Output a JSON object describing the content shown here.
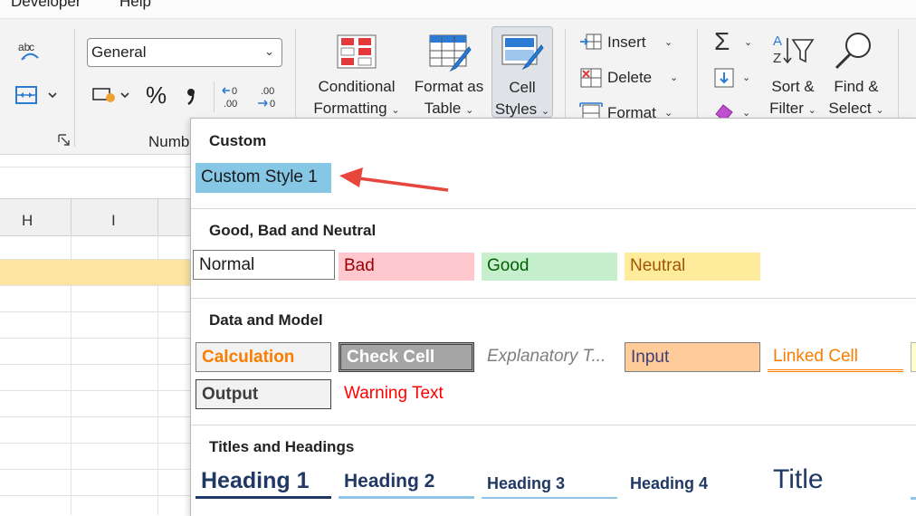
{
  "menubar": {
    "items": [
      "Developer",
      "Help"
    ]
  },
  "ribbon": {
    "number_format": "General",
    "number_group_label": "Numbe",
    "percent_symbol": "%",
    "comma_symbol": "̩",
    "increase_decimal": ".00",
    "decrease_decimal": ".00",
    "conditional_formatting": [
      "Conditional",
      "Formatting"
    ],
    "format_as_table": [
      "Format as",
      "Table"
    ],
    "cell_styles": [
      "Cell",
      "Styles"
    ],
    "insert": "Insert",
    "delete": "Delete",
    "format": "Format",
    "sort_filter": [
      "Sort &",
      "Filter"
    ],
    "find_select": [
      "Find &",
      "Select"
    ],
    "caret": "⌄"
  },
  "sheet": {
    "columns": [
      "H",
      "I"
    ],
    "highlight_color": "#fbe5a0"
  },
  "gallery": {
    "sections": {
      "custom": "Custom",
      "good_bad_neutral": "Good, Bad and Neutral",
      "data_model": "Data and Model",
      "titles_headings": "Titles and Headings"
    },
    "custom_styles": [
      "Custom Style 1"
    ],
    "good_bad": {
      "normal": "Normal",
      "bad": "Bad",
      "good": "Good",
      "neutral": "Neutral"
    },
    "data_model": {
      "calculation": "Calculation",
      "check_cell": "Check Cell",
      "explanatory": "Explanatory T...",
      "input": "Input",
      "linked_cell": "Linked Cell",
      "output": "Output",
      "warning": "Warning Text"
    },
    "headings": {
      "h1": "Heading 1",
      "h2": "Heading 2",
      "h3": "Heading 3",
      "h4": "Heading 4",
      "title": "Title"
    }
  },
  "colors": {
    "custom_style": "#87c7e6",
    "bad_bg": "#ffc7ce",
    "bad_fg": "#9c0006",
    "good_bg": "#c6efce",
    "good_fg": "#006100",
    "neutral_bg": "#ffeb9c",
    "neutral_fg": "#9c5700",
    "arrow": "#e8453c",
    "heading_blue": "#1f3864"
  }
}
